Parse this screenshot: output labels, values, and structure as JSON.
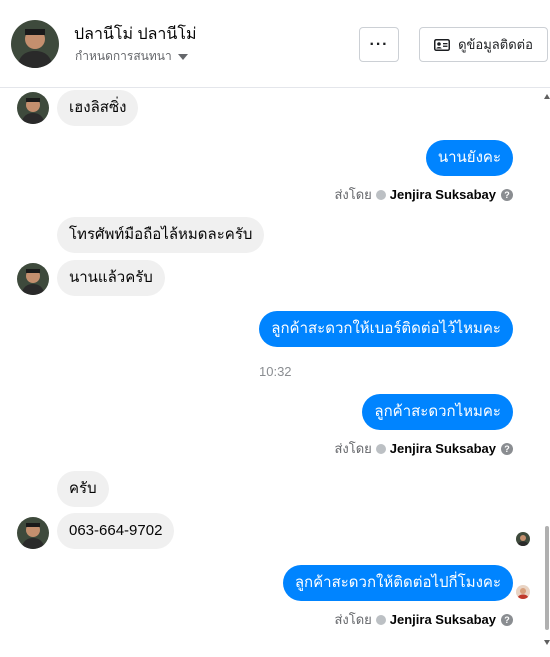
{
  "header": {
    "name": "ปลานีโม่ ปลานีโม่",
    "subtitle": "กำหนดการสนทนา",
    "more_label": "···",
    "contact_info_label": "ดูข้อมูลติดต่อ"
  },
  "messages": {
    "m1": "เฮงลิสซิ่ง",
    "m2": "นานยังคะ",
    "m3": "โทรศัพท์มือถือไล้หมดละครับ",
    "m4": "นานแล้วครับ",
    "m5": "ลูกค้าสะดวกให้เบอร์ติดต่อไว้ไหมคะ",
    "m6": "ลูกค้าสะดวกไหมคะ",
    "m7": "ครับ",
    "m8": "063-664-9702",
    "m9": "ลูกค้าสะดวกให้ติดต่อไปกี่โมงคะ"
  },
  "timestamp": "10:32",
  "sent_by": {
    "prefix": "ส่งโดย",
    "agent": "Jenjira Suksabay",
    "help": "?"
  },
  "colors": {
    "outgoing_bubble": "#0084ff",
    "incoming_bubble": "#f0f0f0"
  }
}
